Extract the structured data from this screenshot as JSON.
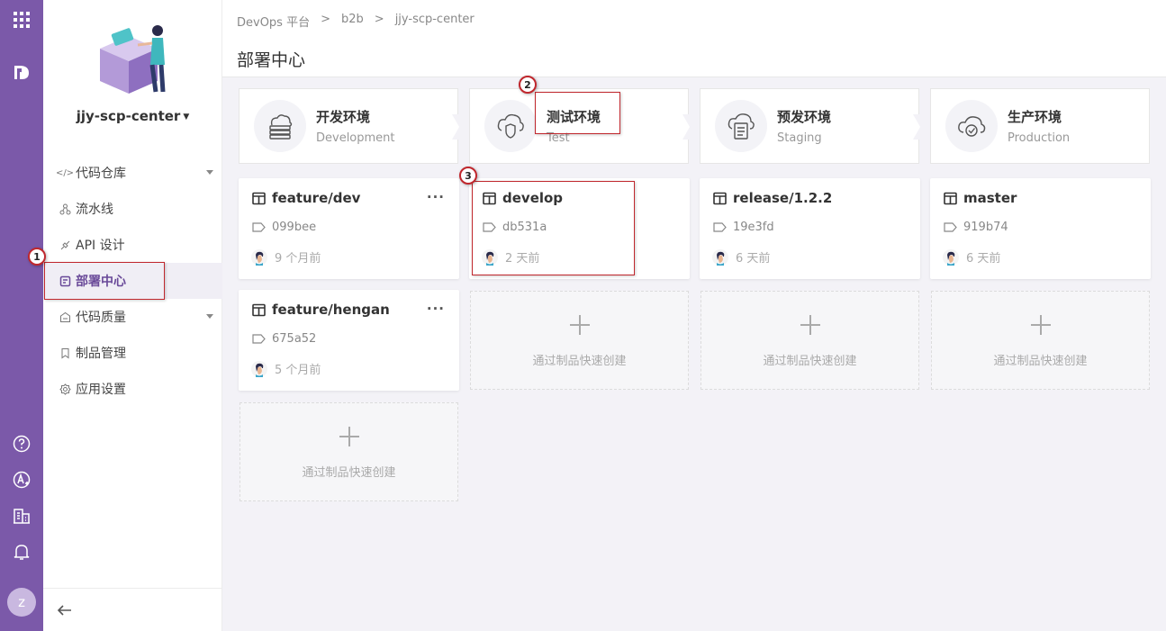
{
  "rail": {
    "icons": [
      "apps-grid-icon",
      "logo-icon",
      "help-icon",
      "api-icon",
      "organization-icon",
      "notification-icon"
    ],
    "avatar_letter": "z"
  },
  "sidebar": {
    "app_name": "jjy-scp-center",
    "items": [
      {
        "label": "代码仓库",
        "icon": "code-icon",
        "has_arrow": true
      },
      {
        "label": "流水线",
        "icon": "pipeline-icon",
        "has_arrow": false
      },
      {
        "label": "API 设计",
        "icon": "api-design-icon",
        "has_arrow": false
      },
      {
        "label": "部署中心",
        "icon": "deploy-icon",
        "has_arrow": false,
        "active": true
      },
      {
        "label": "代码质量",
        "icon": "quality-icon",
        "has_arrow": true
      },
      {
        "label": "制品管理",
        "icon": "bookmark-icon",
        "has_arrow": false
      },
      {
        "label": "应用设置",
        "icon": "settings-icon",
        "has_arrow": false
      }
    ]
  },
  "header": {
    "breadcrumb": [
      "DevOps 平台",
      "b2b",
      "jjy-scp-center"
    ],
    "breadcrumb_sep": ">",
    "title": "部署中心"
  },
  "stages": [
    {
      "name": "开发环境",
      "desc": "Development",
      "icon": "cloud-server-icon"
    },
    {
      "name": "测试环境",
      "desc": "Test",
      "icon": "cloud-shield-icon"
    },
    {
      "name": "预发环境",
      "desc": "Staging",
      "icon": "cloud-doc-icon"
    },
    {
      "name": "生产环境",
      "desc": "Production",
      "icon": "cloud-check-icon"
    }
  ],
  "cards": [
    {
      "branch": "feature/dev",
      "commit": "099bee",
      "time": "9 个月前",
      "more": "···"
    },
    {
      "branch": "develop",
      "commit": "db531a",
      "time": "2 天前"
    },
    {
      "branch": "release/1.2.2",
      "commit": "19e3fd",
      "time": "6 天前"
    },
    {
      "branch": "master",
      "commit": "919b74",
      "time": "6 天前"
    },
    {
      "branch": "feature/hengan",
      "commit": "675a52",
      "time": "5 个月前",
      "more": "···"
    }
  ],
  "placeholder_text": "通过制品快速创建",
  "markers": [
    "1",
    "2",
    "3"
  ],
  "colors": {
    "rail": "#7b59a9",
    "accent": "#6a4a99",
    "annotation": "#c0272d"
  }
}
